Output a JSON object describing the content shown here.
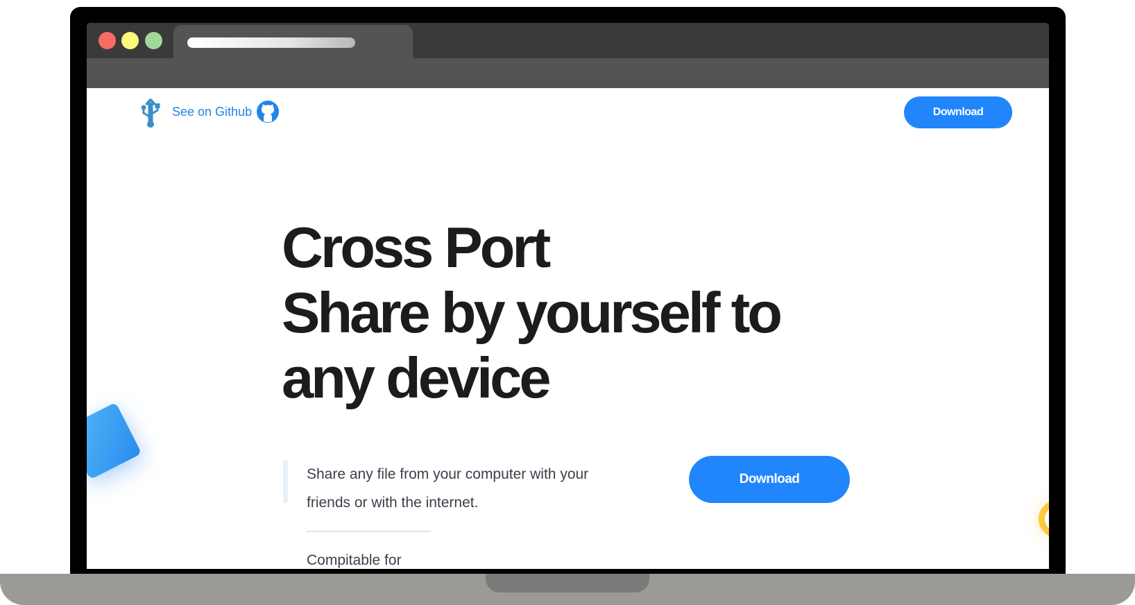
{
  "nav": {
    "logo_icon": "usb-icon",
    "github_label": "See on Github",
    "github_icon": "github-icon",
    "download_label": "Download"
  },
  "hero": {
    "title_lines": [
      "Cross Port",
      "Share by yourself to",
      "any device"
    ],
    "description": "Share any file from your computer with your friends or with the internet.",
    "download_label": "Download",
    "compat_label": "Compitable for"
  },
  "colors": {
    "accent": "#2186fb",
    "link": "#2284e6",
    "heading": "#1c1c1c",
    "body_text": "#3b3f4a",
    "decor_yellow": "#ffc93f"
  }
}
